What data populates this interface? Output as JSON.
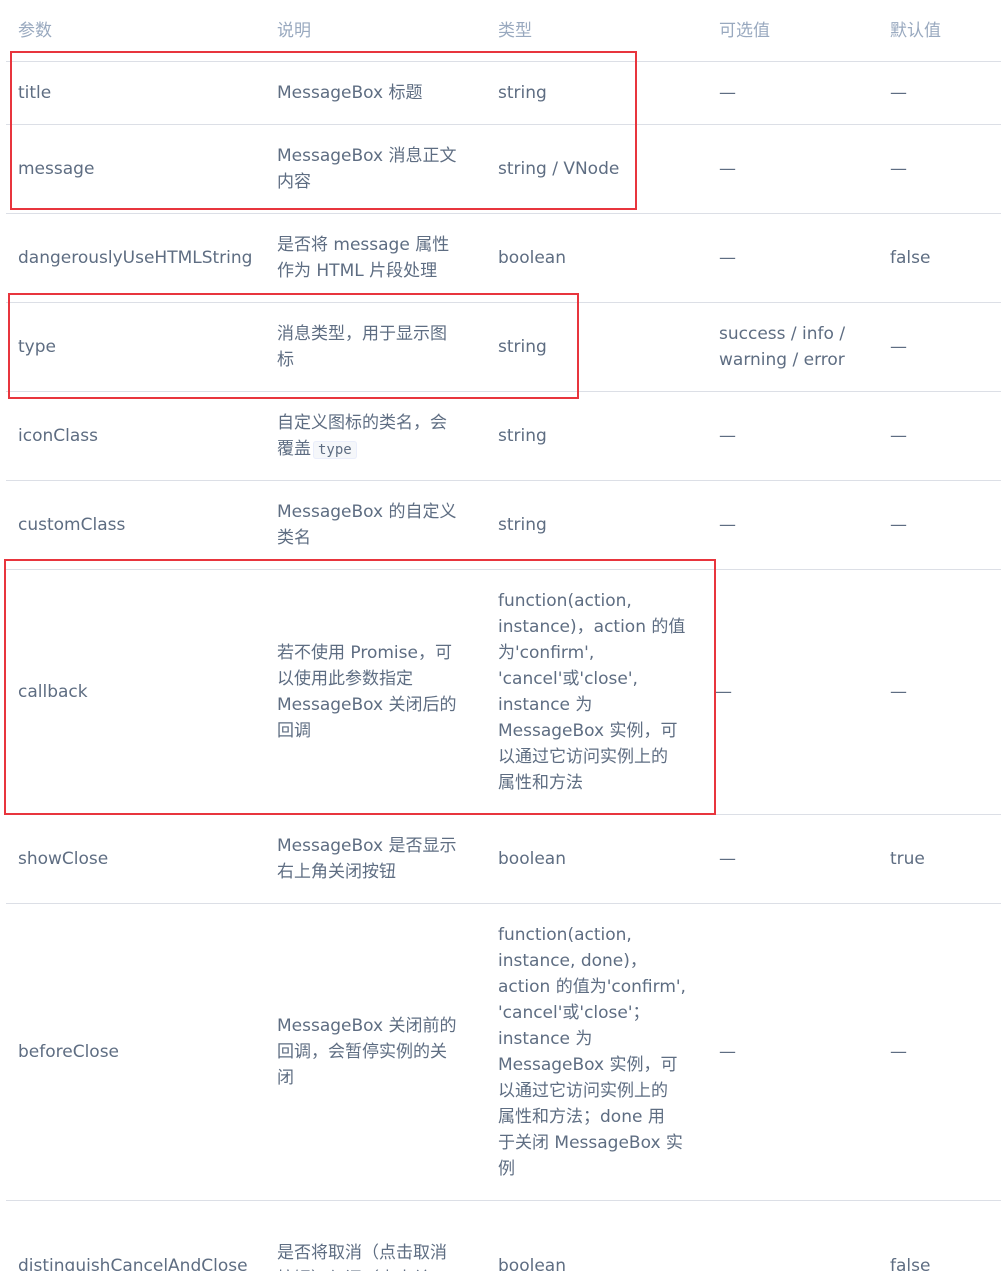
{
  "headers": [
    "参数",
    "说明",
    "类型",
    "可选值",
    "默认值"
  ],
  "rows": [
    {
      "param": "title",
      "desc": "MessageBox 标题",
      "type": "string",
      "options": "—",
      "default": "—"
    },
    {
      "param": "message",
      "desc": "MessageBox 消息正文\n内容",
      "type": "string / VNode",
      "options": "—",
      "default": "—"
    },
    {
      "param": "dangerouslyUseHTMLString",
      "desc": "是否将 message 属性\n作为 HTML 片段处理",
      "type": "boolean",
      "options": "—",
      "default": "false"
    },
    {
      "param": "type",
      "desc": "消息类型，用于显示图\n标",
      "type": "string",
      "options": "success / info /\nwarning / error",
      "default": "—"
    },
    {
      "param": "iconClass",
      "desc": "自定义图标的类名，会\n覆盖",
      "desc_code": "type",
      "type": "string",
      "options": "—",
      "default": "—"
    },
    {
      "param": "customClass",
      "desc": "MessageBox 的自定义\n类名",
      "type": "string",
      "options": "—",
      "default": "—"
    },
    {
      "param": "callback",
      "desc": "若不使用 Promise，可\n以使用此参数指定\nMessageBox 关闭后的\n回调",
      "type": "function(action,\ninstance)，action 的值\n为'confirm',\n'cancel'或'close',\ninstance 为\nMessageBox 实例，可\n以通过它访问实例上的\n属性和方法",
      "options": "—",
      "default": "—"
    },
    {
      "param": "showClose",
      "desc": "MessageBox 是否显示\n右上角关闭按钮",
      "type": "boolean",
      "options": "—",
      "default": "true"
    },
    {
      "param": "beforeClose",
      "desc": "MessageBox 关闭前的\n回调，会暂停实例的关\n闭",
      "type": "function(action,\ninstance, done)，\naction 的值为'confirm',\n'cancel'或'close'；\ninstance 为\nMessageBox 实例，可\n以通过它访问实例上的\n属性和方法；done 用\n于关闭 MessageBox 实\n例",
      "options": "—",
      "default": "—"
    },
    {
      "param": "distinguishCancelAndClose",
      "desc": "是否将取消（点击取消\n按钮）与闭（点击关",
      "type": "boolean",
      "options": "",
      "default": "false"
    }
  ]
}
